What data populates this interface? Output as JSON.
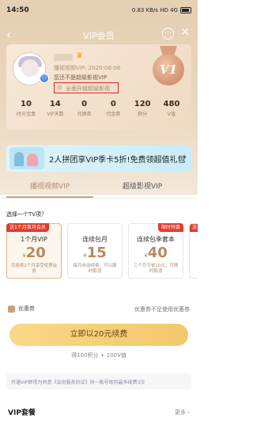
{
  "status_bar": {
    "time": "14:50",
    "indicators": "0.83 KB/s  HD  4G  ",
    "battery": ""
  },
  "nav": {
    "back": "‹",
    "title": "VIP会员",
    "more": "···",
    "close": "✕"
  },
  "user": {
    "vip_info": "播视视频VIP: 2020-08-06",
    "vip_desc": "您还不是超级影视VIP",
    "upgrade_link": "全面升级超级影视"
  },
  "medal": {
    "label": "V1"
  },
  "stats": [
    {
      "value": "10",
      "label": "时光宝盒"
    },
    {
      "value": "14",
      "label": "VIP天数"
    },
    {
      "value": "0",
      "label": "兑换券"
    },
    {
      "value": "0",
      "label": "代金券"
    },
    {
      "value": "120",
      "label": "积分"
    },
    {
      "value": "480",
      "label": "V值"
    }
  ],
  "banner": {
    "text": "2人拼团享VIP季卡5折!免费领超值礼包",
    "arrow": "›"
  },
  "tabs": {
    "active": "播视视频VIP",
    "inactive": "超级影视VIP"
  },
  "section_label": "选择一个TV项？",
  "packages": [
    {
      "tag": "送1个月首月会员",
      "name": "1个月VIP",
      "currency": "¥",
      "price": "20",
      "desc": "可连续1个月享受优质会员"
    },
    {
      "tag": "",
      "name": "连续包月",
      "currency": "¥",
      "price": "15",
      "desc": "每月自动续费，可以随时取消"
    },
    {
      "tag": "",
      "tag_right": "限时特惠",
      "name": "连续包季套本",
      "currency": "¥",
      "price": "40",
      "desc": "三个月节省10元，可随时取消"
    },
    {
      "tag": "送1个月首",
      "name": "连续",
      "currency": "¥",
      "price": "",
      "desc": "三个月节省"
    }
  ],
  "agree": {
    "label": "优惠券",
    "right_text": "优惠券不足使用优惠券"
  },
  "cta": {
    "label": "立即以20元续费",
    "sub": "得100积分 + 100V值"
  },
  "notice": "开通VIP即视为同意《会员服务协议》同一账号每月最多续费3次",
  "bottom": {
    "title": "VIP套餐",
    "more": "更多 ›"
  },
  "colors": {
    "accent": "#c9a27d",
    "price": "#b48a5f",
    "cta": "#f2c86a",
    "tag": "#e33b2c",
    "outline": "#e2251b"
  }
}
